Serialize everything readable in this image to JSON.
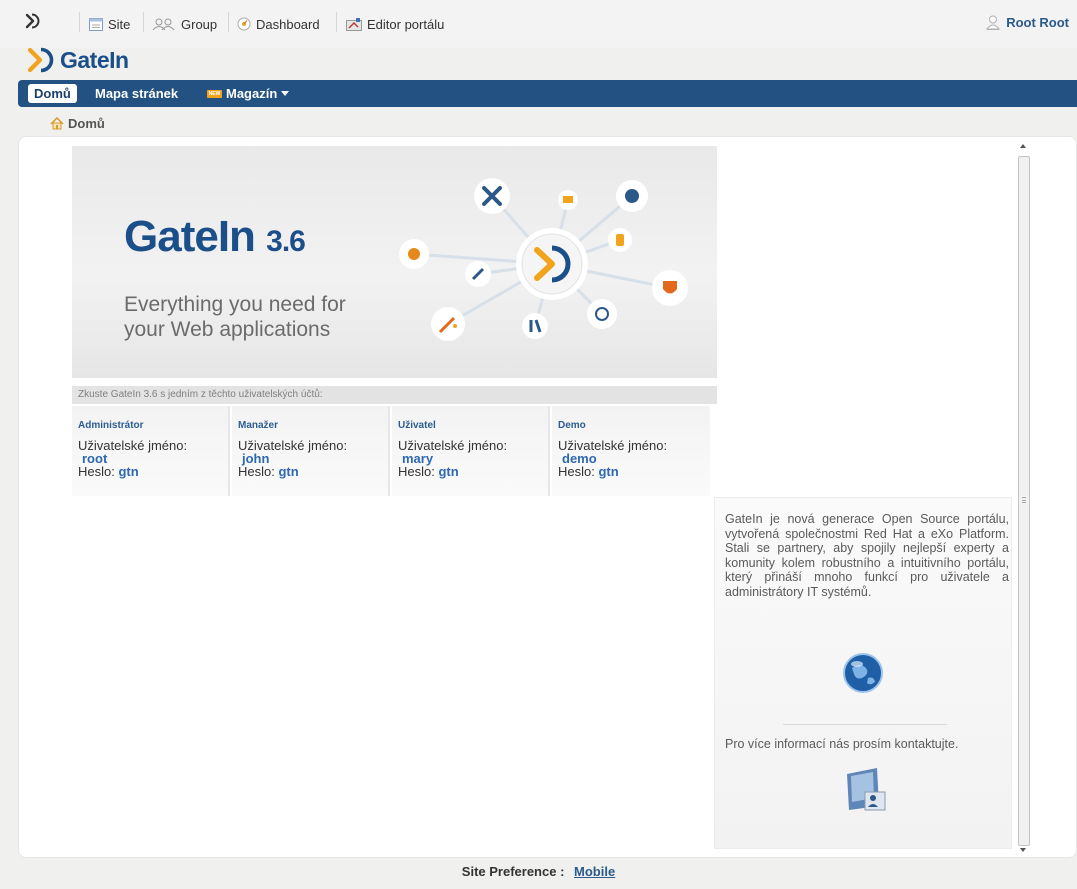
{
  "toolbar": {
    "site_label": "Site",
    "group_label": "Group",
    "dashboard_label": "Dashboard",
    "editor_label": "Editor portálu",
    "user_label": "Root Root"
  },
  "brand": {
    "name": "GateIn"
  },
  "nav": {
    "home_label": "Domů",
    "sitemap_label": "Mapa stránek",
    "new_badge": "NEW",
    "magazine_label": "Magazín"
  },
  "breadcrumb": {
    "label": "Domů"
  },
  "banner": {
    "title": "GateIn",
    "version": "3.6",
    "subtitle": "Everything you need for your Web applications"
  },
  "try_text": "Zkuste GateIn 3.6 s jedním z těchto uživatelských účtů:",
  "accounts": [
    {
      "role": "Administrátor",
      "user_label": "Uživatelské jméno:",
      "username": "root",
      "pass_label": "Heslo:",
      "password": "gtn"
    },
    {
      "role": "Manažer",
      "user_label": "Uživatelské jméno:",
      "username": "john",
      "pass_label": "Heslo:",
      "password": "gtn"
    },
    {
      "role": "Uživatel",
      "user_label": "Uživatelské jméno:",
      "username": "mary",
      "pass_label": "Heslo:",
      "password": "gtn"
    },
    {
      "role": "Demo",
      "user_label": "Uživatelské jméno:",
      "username": "demo",
      "pass_label": "Heslo:",
      "password": "gtn"
    }
  ],
  "info": {
    "text": "GateIn je nová generace Open Source portálu, vytvořená společnostmi Red Hat a eXo Platform. Stali se partnery, aby spojily nejlepší experty a komunity kolem robustního a intuitivního portálu, který přináší mnoho funkcí pro uživatele a administrátory IT systémů.",
    "contact": "Pro více informací nás prosím kontaktujte."
  },
  "footer": {
    "label": "Site Preference :",
    "link": "Mobile"
  },
  "colors": {
    "nav_bg": "#225182",
    "brand_blue": "#1a4f8a",
    "link_blue": "#2d68b0"
  }
}
